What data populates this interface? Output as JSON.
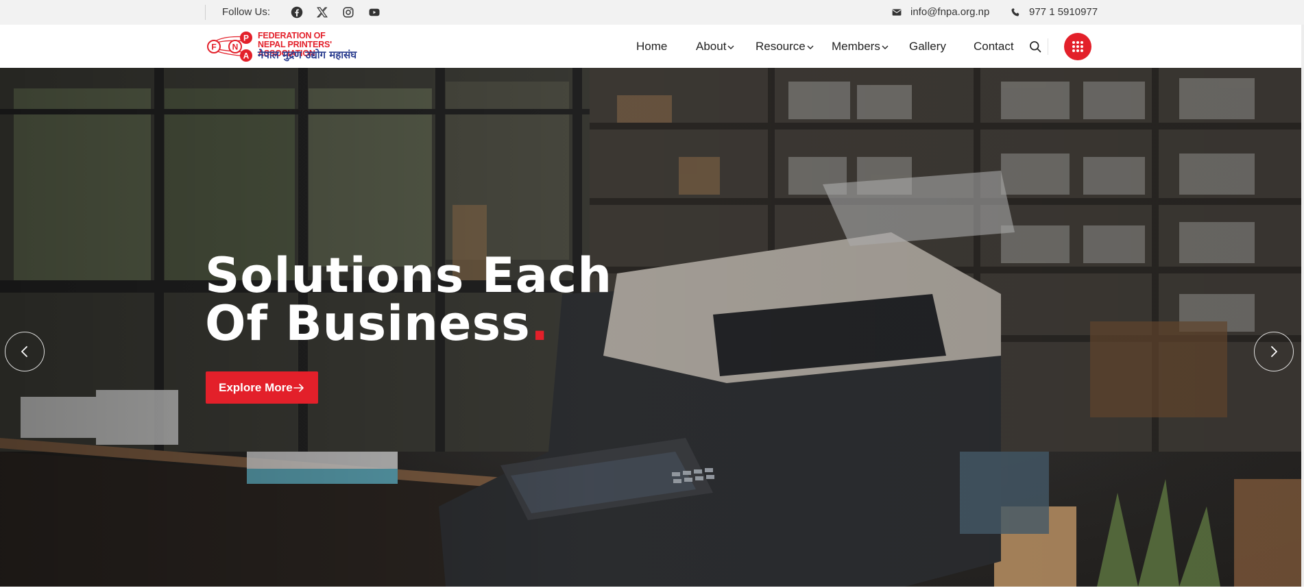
{
  "topbar": {
    "follow_label": "Follow Us:",
    "social_icons": [
      "facebook-icon",
      "x-twitter-icon",
      "instagram-icon",
      "youtube-icon"
    ],
    "email": "info@fnpa.org.np",
    "phone": "977 1 5910977"
  },
  "logo": {
    "line1": "FEDERATION OF",
    "line2": "NEPAL PRINTERS' ASSOCIATION",
    "devanagari": "नेपाल मुद्रण उद्योग महासंघ",
    "initials": [
      "F",
      "N",
      "P",
      "A"
    ]
  },
  "nav": {
    "items": [
      {
        "label": "Home",
        "has_dropdown": false
      },
      {
        "label": "About",
        "has_dropdown": true
      },
      {
        "label": "Resource",
        "has_dropdown": true
      },
      {
        "label": "Members",
        "has_dropdown": true
      },
      {
        "label": "Gallery",
        "has_dropdown": false
      },
      {
        "label": "Contact",
        "has_dropdown": false
      }
    ]
  },
  "hero": {
    "title_line1": "Solutions Each",
    "title_line2": "Of Business",
    "title_dot": ".",
    "cta_label": "Explore More"
  },
  "colors": {
    "accent": "#e3202a",
    "logo_blue": "#2a3d8f",
    "topbar_bg": "#f2f2f2"
  }
}
